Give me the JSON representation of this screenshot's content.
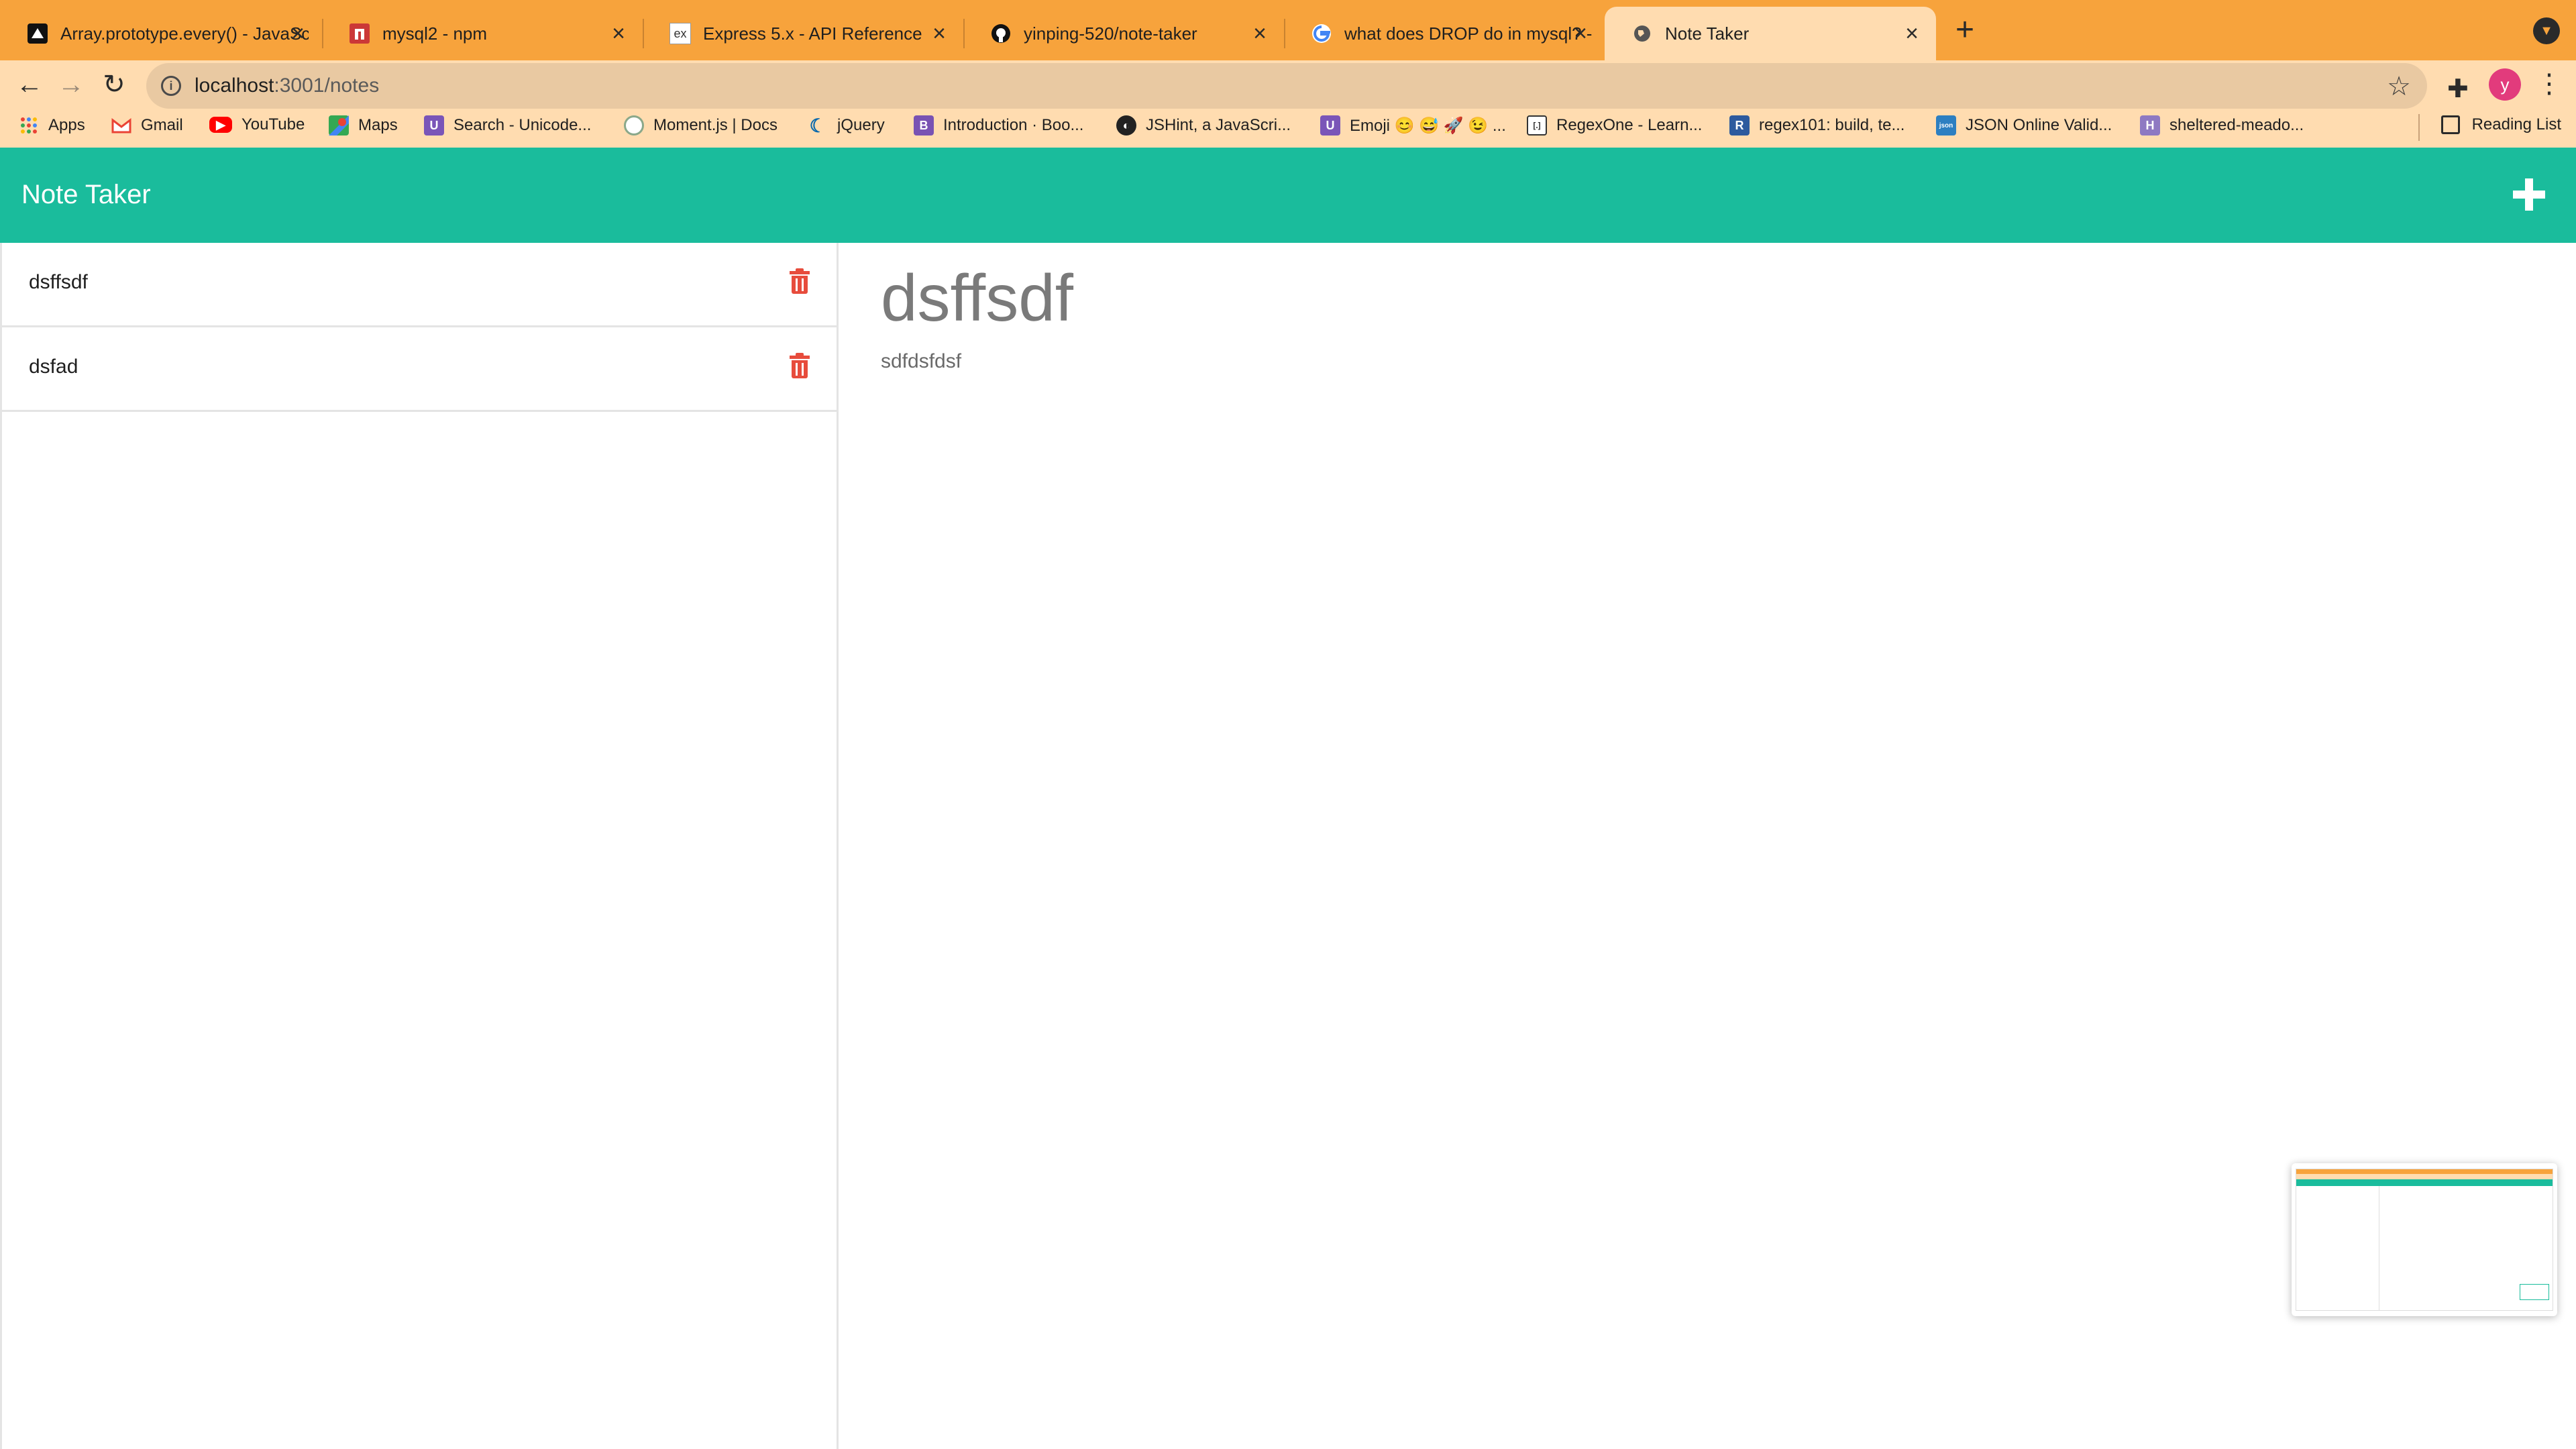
{
  "browser": {
    "tabs": [
      {
        "title": "Array.prototype.every() - JavaScript | MDN",
        "icon": "mdn-icon"
      },
      {
        "title": "mysql2 - npm",
        "icon": "npm-icon"
      },
      {
        "title": "Express 5.x - API Reference",
        "icon": "express-icon"
      },
      {
        "title": "yinping-520/note-taker",
        "icon": "github-icon"
      },
      {
        "title": "what does DROP do in mysql? - Google Search",
        "icon": "google-icon"
      },
      {
        "title": "Note Taker",
        "icon": "globe-icon",
        "active": true
      }
    ],
    "url_host": "localhost",
    "url_path": ":3001/notes",
    "avatar_letter": "y",
    "bookmarks": [
      {
        "label": "Apps",
        "icon": "apps-grid-icon"
      },
      {
        "label": "Gmail",
        "icon": "gmail-icon"
      },
      {
        "label": "YouTube",
        "icon": "youtube-icon"
      },
      {
        "label": "Maps",
        "icon": "maps-icon"
      },
      {
        "label": "Search - Unicode...",
        "icon": "unicode-icon"
      },
      {
        "label": "Moment.js | Docs",
        "icon": "moment-icon"
      },
      {
        "label": "jQuery",
        "icon": "jquery-icon"
      },
      {
        "label": "Introduction · Boo...",
        "icon": "bootstrap-icon"
      },
      {
        "label": "JSHint, a JavaScri...",
        "icon": "jshint-icon"
      },
      {
        "label": "Emoji 😊 😅 🚀 😉 ...",
        "icon": "emoji-icon"
      },
      {
        "label": "RegexOne - Learn...",
        "icon": "regexone-icon"
      },
      {
        "label": "regex101: build, te...",
        "icon": "regex101-icon"
      },
      {
        "label": "JSON Online Valid...",
        "icon": "json-icon"
      },
      {
        "label": "sheltered-meado...",
        "icon": "heroku-icon"
      }
    ],
    "reading_list": "Reading List"
  },
  "app": {
    "brand": "Note Taker",
    "notes": [
      {
        "title": "dsffsdf"
      },
      {
        "title": "dsfad"
      }
    ],
    "active_note": {
      "title": "dsffsdf",
      "text": "sdfdsfdsf"
    },
    "colors": {
      "accent": "#1abc9c",
      "delete": "#e74c3c",
      "tabstrip": "#f7a33c"
    }
  }
}
